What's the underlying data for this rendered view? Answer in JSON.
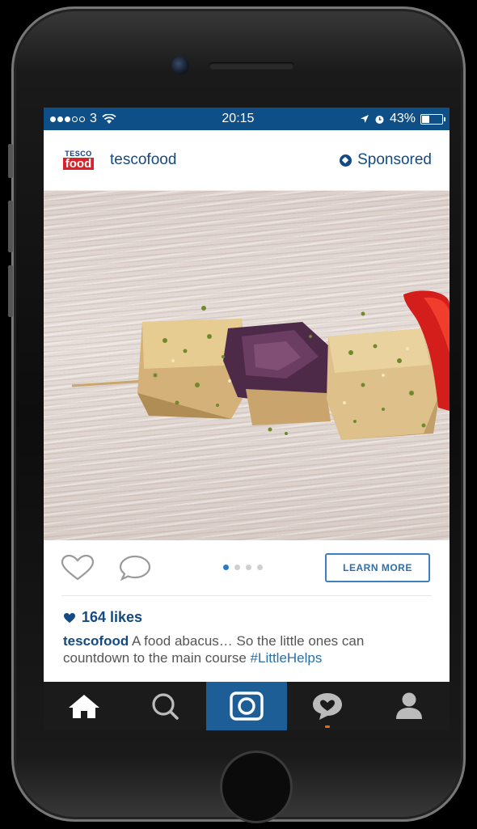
{
  "status": {
    "carrier": "3",
    "time": "20:15",
    "battery": "43%",
    "battery_level": 0.43
  },
  "post": {
    "avatar_top": "TESCO",
    "avatar_bottom": "food",
    "username": "tescofood",
    "sponsored_label": "Sponsored",
    "image_icon": "food-skewer-photo",
    "learn_more_label": "LEARN MORE",
    "pager": {
      "count": 4,
      "active_index": 0
    },
    "likes": "164 likes",
    "caption": {
      "user": "tescofood",
      "text": " A food abacus… So the little ones can countdown to the main course ",
      "hashtag": "#LittleHelps"
    }
  },
  "tabs": [
    {
      "name": "home",
      "icon": "home-icon"
    },
    {
      "name": "explore",
      "icon": "search-icon"
    },
    {
      "name": "camera",
      "icon": "camera-icon"
    },
    {
      "name": "activity",
      "icon": "activity-heart-bubble-icon"
    },
    {
      "name": "profile",
      "icon": "profile-icon"
    }
  ],
  "colors": {
    "brand_blue": "#0e4f87",
    "link_blue": "#134a83",
    "tab_active": "#1d5e97",
    "tesco_red": "#d8232a"
  }
}
